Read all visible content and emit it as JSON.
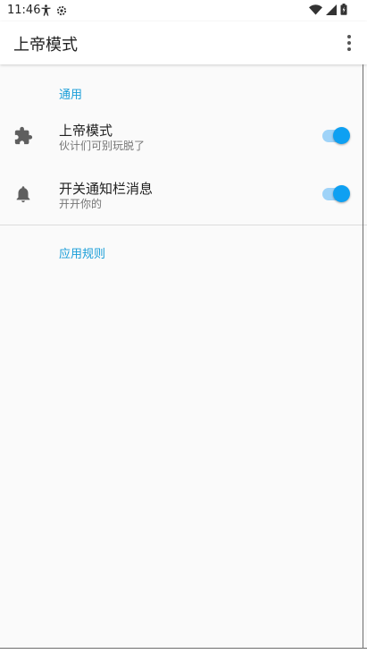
{
  "status_bar": {
    "time": "11:46",
    "left_icons": [
      "accessibility-icon",
      "settings-gear-icon"
    ],
    "right_icons": [
      "wifi-icon",
      "signal-icon",
      "battery-icon"
    ]
  },
  "app_bar": {
    "title": "上帝模式",
    "menu_icon": "more-vert-icon"
  },
  "sections": [
    {
      "header": "通用",
      "items": [
        {
          "title": "上帝模式",
          "summary": "伙计们可别玩脱了",
          "icon": "puzzle-icon",
          "switch_on": true
        },
        {
          "title": "开关通知栏消息",
          "summary": "开开你的",
          "icon": "bell-icon",
          "switch_on": true
        }
      ]
    },
    {
      "header": "应用规则",
      "items": []
    }
  ],
  "colors": {
    "accent": "#0ea0f2",
    "accent_track": "#9fd3f8",
    "section_header": "#1a9ed8"
  }
}
